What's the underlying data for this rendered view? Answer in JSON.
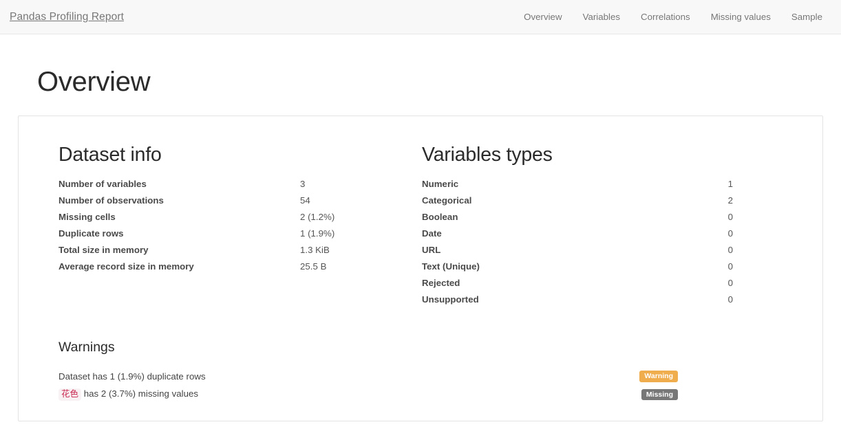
{
  "navbar": {
    "brand": "Pandas Profiling Report",
    "links": [
      {
        "label": "Overview"
      },
      {
        "label": "Variables"
      },
      {
        "label": "Correlations"
      },
      {
        "label": "Missing values"
      },
      {
        "label": "Sample"
      }
    ]
  },
  "page": {
    "title": "Overview"
  },
  "dataset_info": {
    "title": "Dataset info",
    "rows": [
      {
        "label": "Number of variables",
        "value": "3"
      },
      {
        "label": "Number of observations",
        "value": "54"
      },
      {
        "label": "Missing cells",
        "value": "2 (1.2%)"
      },
      {
        "label": "Duplicate rows",
        "value": "1 (1.9%)"
      },
      {
        "label": "Total size in memory",
        "value": "1.3 KiB"
      },
      {
        "label": "Average record size in memory",
        "value": "25.5 B"
      }
    ]
  },
  "variables_types": {
    "title": "Variables types",
    "rows": [
      {
        "label": "Numeric",
        "value": "1"
      },
      {
        "label": "Categorical",
        "value": "2"
      },
      {
        "label": "Boolean",
        "value": "0"
      },
      {
        "label": "Date",
        "value": "0"
      },
      {
        "label": "URL",
        "value": "0"
      },
      {
        "label": "Text (Unique)",
        "value": "0"
      },
      {
        "label": "Rejected",
        "value": "0"
      },
      {
        "label": "Unsupported",
        "value": "0"
      }
    ]
  },
  "warnings": {
    "title": "Warnings",
    "items": [
      {
        "code": "",
        "text": "Dataset has 1 (1.9%) duplicate rows",
        "badge": "Warning",
        "badge_type": "warning"
      },
      {
        "code": "花色",
        "text": "has 2 (3.7%) missing values",
        "badge": "Missing",
        "badge_type": "default"
      }
    ]
  },
  "colors": {
    "navbar_bg": "#f8f8f8",
    "navbar_border": "#e7e7e7",
    "brand_text": "#777777",
    "heading_text": "#2b2b2b",
    "card_border": "#e3e3e3",
    "badge_warning": "#f0ad4e",
    "badge_default": "#777777",
    "code_text": "#c7254e",
    "code_bg": "#f9f2f4"
  }
}
